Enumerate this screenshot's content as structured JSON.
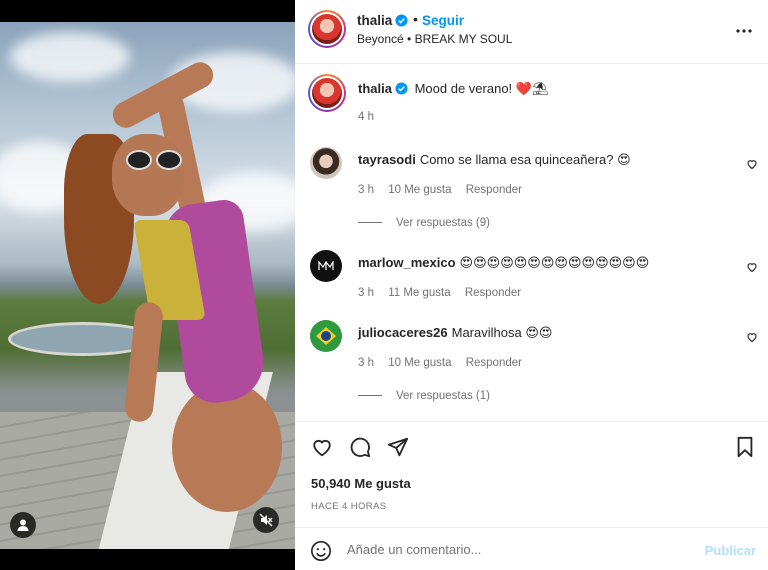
{
  "post": {
    "author": "thalia",
    "follow_label": "Seguir",
    "separator": "•",
    "audio": "Beyoncé • BREAK MY SOUL",
    "caption_text": "Mood de verano! ❤️⛱",
    "caption_time": "4 h"
  },
  "comments": [
    {
      "user": "tayrasodi",
      "text": "Como se llama esa quinceañera? 😍",
      "time": "3 h",
      "likes": "10 Me gusta",
      "reply": "Responder",
      "view_replies": "Ver respuestas (9)"
    },
    {
      "user": "marlow_mexico",
      "text": "😍😍😍😍😍😍😍😍😍😍😍😍😍😍",
      "time": "3 h",
      "likes": "11 Me gusta",
      "reply": "Responder"
    },
    {
      "user": "juliocaceres26",
      "text": "Maravilhosa 😍😍",
      "time": "3 h",
      "likes": "10 Me gusta",
      "reply": "Responder",
      "view_replies": "Ver respuestas (1)"
    }
  ],
  "stats": {
    "likes": "50,940 Me gusta",
    "ago": "HACE 4 HORAS"
  },
  "composer": {
    "placeholder": "Añade un comentario...",
    "publish_label": "Publicar"
  },
  "icons": {
    "more": "more-options-icon",
    "like": "heart-icon",
    "comment": "comment-icon",
    "share": "share-icon",
    "save": "bookmark-icon",
    "emoji": "emoji-icon",
    "user_tag": "user-tag-icon",
    "mute": "muted-icon",
    "verified": "verified-badge-icon"
  },
  "colors": {
    "accent": "#0095f6",
    "verified": "#0095f6",
    "publish_disabled": "#b2dffc",
    "secondary_text": "#737373"
  }
}
